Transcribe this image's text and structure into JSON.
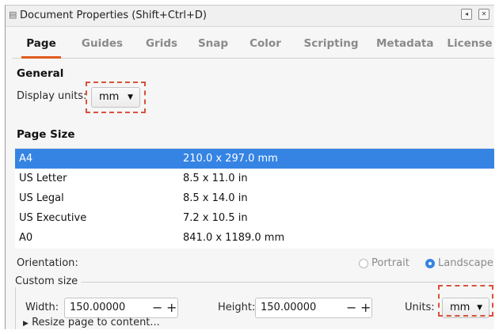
{
  "window": {
    "title": "Document Properties (Shift+Ctrl+D)",
    "icons": [
      "document-icon",
      "restore-icon",
      "close-icon"
    ]
  },
  "tabs": [
    {
      "label": "Page",
      "active": true
    },
    {
      "label": "Guides",
      "active": false
    },
    {
      "label": "Grids",
      "active": false
    },
    {
      "label": "Snap",
      "active": false
    },
    {
      "label": "Color",
      "active": false
    },
    {
      "label": "Scripting",
      "active": false
    },
    {
      "label": "Metadata",
      "active": false
    },
    {
      "label": "License",
      "active": false
    }
  ],
  "general": {
    "heading": "General",
    "display_units_label": "Display units:",
    "display_units_value": "mm"
  },
  "page_size": {
    "heading": "Page Size",
    "rows": [
      {
        "name": "A4",
        "size": "210.0 x 297.0 mm",
        "selected": true
      },
      {
        "name": "US Letter",
        "size": "8.5 x 11.0 in",
        "selected": false
      },
      {
        "name": "US Legal",
        "size": "8.5 x 14.0 in",
        "selected": false
      },
      {
        "name": "US Executive",
        "size": "7.2 x 10.5 in",
        "selected": false
      },
      {
        "name": "A0",
        "size": "841.0 x 1189.0 mm",
        "selected": false
      }
    ]
  },
  "orientation": {
    "label": "Orientation:",
    "portrait": "Portrait",
    "landscape": "Landscape",
    "selected": "landscape"
  },
  "custom_size": {
    "label": "Custom size",
    "width_label": "Width:",
    "width_value": "150.00000",
    "height_label": "Height:",
    "height_value": "150.00000",
    "units_label": "Units:",
    "units_value": "mm",
    "minus": "−",
    "plus": "+"
  },
  "resize": {
    "label": "Resize page to content..."
  },
  "colors": {
    "selection": "#3584e4",
    "active_tab_underline": "#e15b1e",
    "highlight_dash": "#d9523b"
  }
}
